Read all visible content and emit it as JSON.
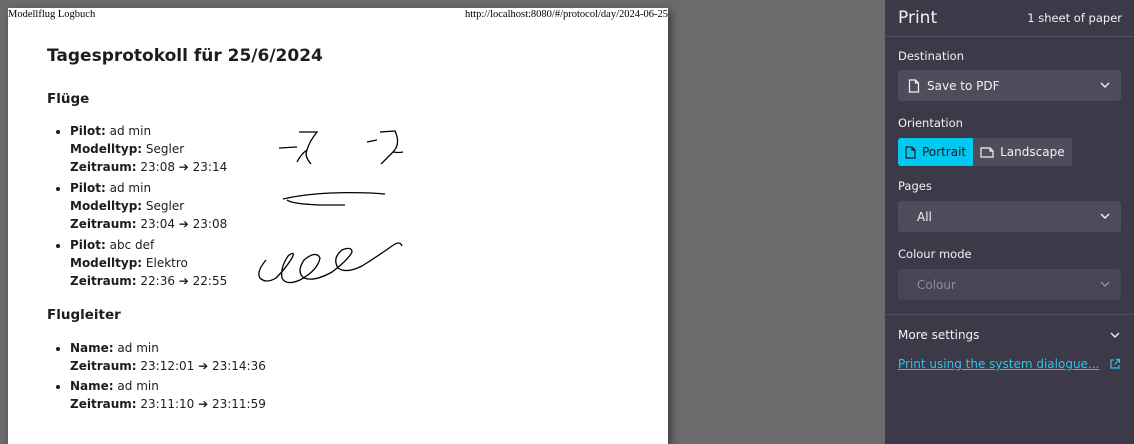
{
  "page": {
    "header_left": "Modellflug Logbuch",
    "header_right": "http://localhost:8080/#/protocol/day/2024-06-25",
    "title": "Tagesprotokoll für 25/6/2024",
    "flights_heading": "Flüge",
    "flights": [
      {
        "pilot_label": "Pilot:",
        "pilot": "ad min",
        "type_label": "Modelltyp:",
        "type": "Segler",
        "time_label": "Zeitraum:",
        "time": "23:08 ➔ 23:14"
      },
      {
        "pilot_label": "Pilot:",
        "pilot": "ad min",
        "type_label": "Modelltyp:",
        "type": "Segler",
        "time_label": "Zeitraum:",
        "time": "23:04 ➔ 23:08"
      },
      {
        "pilot_label": "Pilot:",
        "pilot": "abc def",
        "type_label": "Modelltyp:",
        "type": "Elektro",
        "time_label": "Zeitraum:",
        "time": "22:36 ➔ 22:55"
      }
    ],
    "leaders_heading": "Flugleiter",
    "leaders": [
      {
        "name_label": "Name:",
        "name": "ad min",
        "time_label": "Zeitraum:",
        "time": "23:12:01 ➔ 23:14:36"
      },
      {
        "name_label": "Name:",
        "name": "ad min",
        "time_label": "Zeitraum:",
        "time": "23:11:10 ➔ 23:11:59"
      }
    ]
  },
  "print_panel": {
    "title": "Print",
    "sheet_count": "1 sheet of paper",
    "destination_label": "Destination",
    "destination_value": "Save to PDF",
    "orientation_label": "Orientation",
    "portrait_label": "Portrait",
    "landscape_label": "Landscape",
    "orientation_selected": "Portrait",
    "pages_label": "Pages",
    "pages_value": "All",
    "colour_label": "Colour mode",
    "colour_value": "Colour",
    "more_settings_label": "More settings",
    "system_dialog_label": "Print using the system dialogue...",
    "colors": {
      "panel_bg": "#3c3a48",
      "accent": "#00c8f0",
      "link": "#2fc2ec",
      "select_bg": "#4f4d5c"
    },
    "icons": [
      "document-icon",
      "chevron-down-icon",
      "external-link-icon"
    ]
  }
}
